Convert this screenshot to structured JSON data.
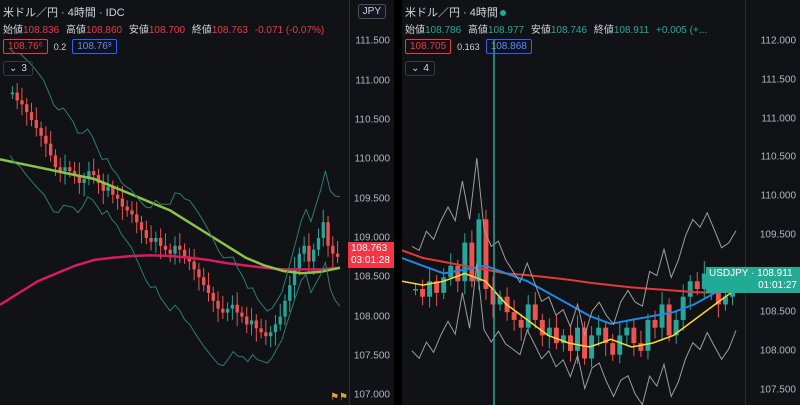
{
  "left": {
    "title": "米ドル／円 · 4時間 · IDC",
    "ohlc": [
      {
        "k": "始値",
        "v": "108.836"
      },
      {
        "k": "高値",
        "v": "108.860"
      },
      {
        "k": "安値",
        "v": "108.700"
      },
      {
        "k": "終値",
        "v": "108.763"
      },
      {
        "k": "",
        "v": "-0.071 (-0.07%)"
      }
    ],
    "sell_price": "108.76⁶",
    "spread": "0.2",
    "buy_price": "108.76⁸",
    "collapsed_count": "3",
    "currency_badge": "JPY",
    "axis_ticks": [
      "111.500",
      "111.000",
      "110.500",
      "110.000",
      "109.500",
      "109.000",
      "108.500",
      "108.000",
      "107.500",
      "107.000"
    ],
    "last_price": "108.763",
    "countdown": "03:01:28",
    "colors": {
      "sma_green": "#8bc34a",
      "sma_magenta": "#d81b60",
      "bands": "#2e7d6a",
      "up": "#26a69a",
      "down": "#ef5350"
    },
    "chart_data": {
      "type": "candlestick",
      "ylim": [
        106.9,
        111.9
      ],
      "closes": [
        110.85,
        110.75,
        110.7,
        110.6,
        110.5,
        110.4,
        110.3,
        110.2,
        110.05,
        109.9,
        109.85,
        109.9,
        109.85,
        109.8,
        109.7,
        109.75,
        109.85,
        109.8,
        109.7,
        109.6,
        109.65,
        109.55,
        109.5,
        109.4,
        109.35,
        109.3,
        109.2,
        109.1,
        109.0,
        108.95,
        109.0,
        108.9,
        108.85,
        108.8,
        108.9,
        108.85,
        108.75,
        108.7,
        108.6,
        108.5,
        108.4,
        108.3,
        108.2,
        108.1,
        108.05,
        108.1,
        108.15,
        108.05,
        108.0,
        107.9,
        107.95,
        107.85,
        107.8,
        107.75,
        107.8,
        107.9,
        108.0,
        108.2,
        108.4,
        108.6,
        108.8,
        108.9,
        108.7,
        108.85,
        109.0,
        109.2,
        108.9,
        108.8,
        108.76
      ],
      "sma_green": [
        110.0,
        109.95,
        109.9,
        109.85,
        109.8,
        109.75,
        109.65,
        109.55,
        109.45,
        109.35,
        109.2,
        109.05,
        108.9,
        108.75,
        108.65,
        108.58,
        108.55,
        108.57,
        108.62
      ],
      "sma_magenta": [
        108.15,
        108.3,
        108.45,
        108.55,
        108.65,
        108.72,
        108.75,
        108.77,
        108.78,
        108.77,
        108.75,
        108.72,
        108.68,
        108.65,
        108.62,
        108.6,
        108.6,
        108.6,
        108.62
      ]
    }
  },
  "right": {
    "title": "米ドル／円 · 4時間",
    "ohlc": [
      {
        "k": "始値",
        "v": "108.786"
      },
      {
        "k": "高値",
        "v": "108.977"
      },
      {
        "k": "安値",
        "v": "108.746"
      },
      {
        "k": "終値",
        "v": "108.911"
      },
      {
        "k": "",
        "v": "+0.005 (+..."
      }
    ],
    "sell_price": "108.705",
    "spread": "0.163",
    "buy_price": "108.868",
    "collapsed_count": "4",
    "axis_ticks": [
      "112.000",
      "111.500",
      "111.000",
      "110.500",
      "110.000",
      "109.500",
      "109.000",
      "108.500",
      "108.000",
      "107.500"
    ],
    "symbol": "USDJPY",
    "last_price": "108.911",
    "countdown": "01:01:27",
    "colors": {
      "ema_red": "#e53935",
      "ma_blue": "#1e88e5",
      "ma_yellow": "#fdd835",
      "bands": "#9e9e9e",
      "up": "#26a69a",
      "down": "#ef5350"
    },
    "chart_data": {
      "type": "candlestick",
      "ylim": [
        107.3,
        112.2
      ],
      "closes": [
        108.8,
        108.7,
        108.9,
        108.75,
        108.95,
        109.1,
        108.9,
        109.4,
        108.9,
        109.7,
        108.8,
        108.6,
        108.7,
        108.5,
        108.4,
        108.3,
        108.6,
        108.4,
        108.2,
        108.3,
        108.1,
        108.2,
        108.0,
        108.3,
        107.9,
        108.2,
        108.3,
        108.1,
        107.95,
        108.2,
        108.3,
        108.1,
        108.0,
        108.4,
        108.3,
        108.6,
        108.2,
        108.4,
        108.7,
        108.9,
        108.8,
        109.0,
        108.8,
        108.6,
        108.7,
        108.9
      ],
      "ema_red": [
        109.3,
        109.2,
        109.15,
        109.1,
        109.05,
        109.0,
        108.98,
        108.95,
        108.92,
        108.88,
        108.85,
        108.82,
        108.8,
        108.78,
        108.76,
        108.75,
        108.8
      ],
      "ma_blue": [
        109.2,
        109.1,
        109.0,
        109.05,
        109.1,
        109.0,
        108.9,
        108.75,
        108.6,
        108.45,
        108.35,
        108.4,
        108.45,
        108.5,
        108.6,
        108.75,
        108.9
      ],
      "ma_yellow": [
        108.9,
        108.85,
        108.9,
        109.0,
        108.9,
        108.6,
        108.4,
        108.2,
        108.1,
        108.05,
        108.15,
        108.05,
        108.1,
        108.2,
        108.4,
        108.6,
        108.8
      ]
    }
  }
}
